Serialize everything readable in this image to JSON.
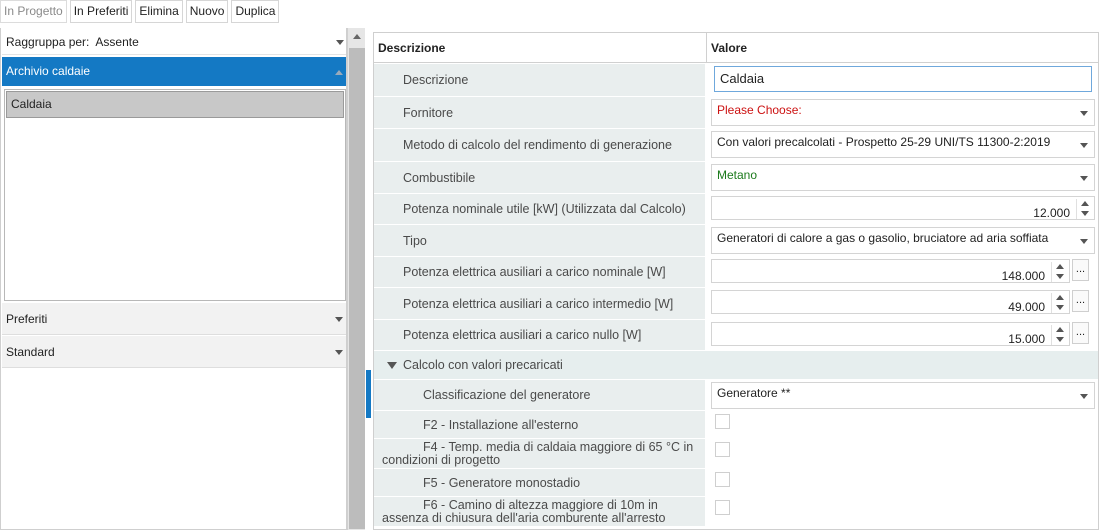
{
  "toolbar": {
    "in_progetto": "In Progetto",
    "in_preferiti": "In Preferiti",
    "elimina": "Elimina",
    "nuovo": "Nuovo",
    "duplica": "Duplica"
  },
  "left": {
    "groupby_label": "Raggruppa per:",
    "groupby_value": "Assente",
    "archive_header": "Archivio caldaie",
    "archive_items": [
      "Caldaia"
    ],
    "groups": [
      "Preferiti",
      "Standard"
    ]
  },
  "grid": {
    "col_desc": "Descrizione",
    "col_val": "Valore",
    "rows": {
      "descrizione": {
        "label": "Descrizione",
        "value": "Caldaia"
      },
      "fornitore": {
        "label": "Fornitore",
        "value": "Please Choose:"
      },
      "metodo": {
        "label": "Metodo di calcolo del rendimento di generazione",
        "value": "Con valori precalcolati - Prospetto 25-29 UNI/TS 11300-2:2019"
      },
      "combustibile": {
        "label": "Combustibile",
        "value": "Metano"
      },
      "potenza_nominale": {
        "label": "Potenza nominale utile [kW] (Utilizzata dal Calcolo)",
        "value": "12.000"
      },
      "tipo": {
        "label": "Tipo",
        "value": "Generatori di calore a gas o gasolio, bruciatore ad aria soffiata"
      },
      "aux_nominale": {
        "label": "Potenza elettrica ausiliari a carico nominale [W]",
        "value": "148.000"
      },
      "aux_intermedio": {
        "label": "Potenza elettrica ausiliari a carico intermedio [W]",
        "value": "49.000"
      },
      "aux_nullo": {
        "label": "Potenza elettrica ausiliari a carico nullo [W]",
        "value": "15.000"
      }
    },
    "section_label": "Calcolo con valori precaricati",
    "sub_rows": {
      "classificazione": {
        "label": "Classificazione del generatore",
        "value": "Generatore **"
      },
      "f2": {
        "label": "F2 - Installazione all'esterno"
      },
      "f4": {
        "label": "F4 - Temp. media di caldaia maggiore di 65 °C in condizioni di progetto"
      },
      "f5": {
        "label": "F5 - Generatore monostadio"
      },
      "f6": {
        "label": "F6 - Camino di altezza maggiore di 10m in assenza di chiusura dell'aria comburente all'arresto"
      }
    },
    "ellipsis": "..."
  },
  "colors": {
    "accent": "#1479c4",
    "row_bg": "#e9eeee",
    "required_red": "#cc1111",
    "ok_green": "#1b7a1b"
  }
}
